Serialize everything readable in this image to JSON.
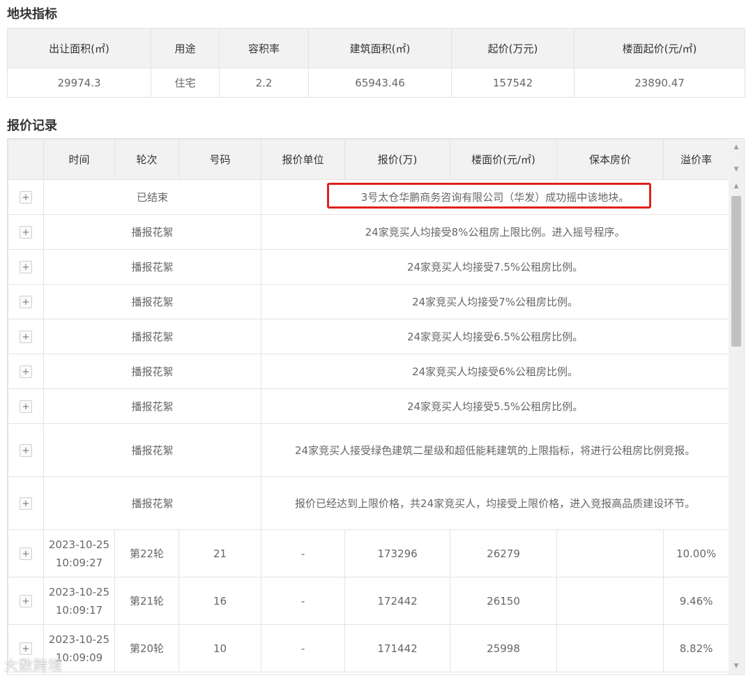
{
  "plot_section": {
    "title": "地块指标",
    "headers": [
      "出让面积(㎡)",
      "用途",
      "容积率",
      "建筑面积(㎡)",
      "起价(万元)",
      "楼面起价(元/㎡)"
    ],
    "values": [
      "29974.3",
      "住宅",
      "2.2",
      "65943.46",
      "157542",
      "23890.47"
    ]
  },
  "bid_section": {
    "title": "报价记录",
    "headers": [
      "",
      "时间",
      "轮次",
      "号码",
      "报价单位",
      "报价(万)",
      "楼面价(元/㎡)",
      "保本房价",
      "溢价率"
    ],
    "expand_symbol": "+",
    "notes": [
      {
        "round": "已结束",
        "text": "3号太仓华鹏商务咨询有限公司（华发）成功摇中该地块。",
        "highlight": true
      },
      {
        "round": "播报花絮",
        "text": "24家竞买人均接受8%公租房上限比例。进入摇号程序。"
      },
      {
        "round": "播报花絮",
        "text": "24家竞买人均接受7.5%公租房比例。"
      },
      {
        "round": "播报花絮",
        "text": "24家竞买人均接受7%公租房比例。"
      },
      {
        "round": "播报花絮",
        "text": "24家竞买人均接受6.5%公租房比例。"
      },
      {
        "round": "播报花絮",
        "text": "24家竞买人均接受6%公租房比例。"
      },
      {
        "round": "播报花絮",
        "text": "24家竞买人均接受5.5%公租房比例。"
      },
      {
        "round": "播报花絮",
        "text": "24家竞买人接受绿色建筑二星级和超低能耗建筑的上限指标，将进行公租房比例竞报。"
      },
      {
        "round": "播报花絮",
        "text": "报价已经达到上限价格，共24家竞买人，均接受上限价格，进入竞报高品质建设环节。"
      }
    ],
    "bids": [
      {
        "date": "2023-10-25",
        "time": "10:09:27",
        "round": "第22轮",
        "number": "21",
        "unit": "-",
        "price": "173296",
        "floor_price": "26279",
        "breakeven": "",
        "premium": "10.00%"
      },
      {
        "date": "2023-10-25",
        "time": "10:09:17",
        "round": "第21轮",
        "number": "16",
        "unit": "-",
        "price": "172442",
        "floor_price": "26150",
        "breakeven": "",
        "premium": "9.46%"
      },
      {
        "date": "2023-10-25",
        "time": "10:09:09",
        "round": "第20轮",
        "number": "10",
        "unit": "-",
        "price": "171442",
        "floor_price": "25998",
        "breakeven": "",
        "premium": "8.82%"
      }
    ],
    "scroll_up_icon": "▲",
    "scroll_down_icon": "▼"
  },
  "watermark": "大数跨境"
}
